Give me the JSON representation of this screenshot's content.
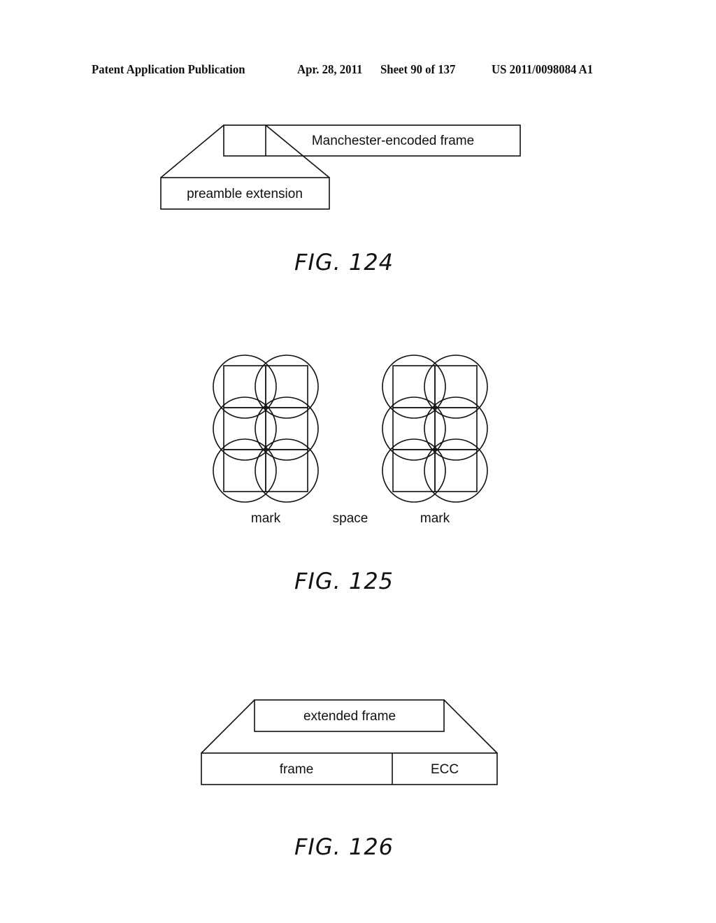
{
  "header": {
    "publication": "Patent Application Publication",
    "date": "Apr. 28, 2011",
    "sheet": "Sheet 90 of 137",
    "number": "US 2011/0098084 A1"
  },
  "fig124": {
    "caption": "FIG. 124",
    "frame_label": "Manchester-encoded frame",
    "extension_label": "preamble extension"
  },
  "fig125": {
    "caption": "FIG. 125",
    "grid": {
      "rows": 3,
      "cols": 2
    },
    "labels": [
      "mark",
      "space",
      "mark"
    ]
  },
  "fig126": {
    "caption": "FIG. 126",
    "extended_label": "extended frame",
    "frame_label": "frame",
    "ecc_label": "ECC"
  }
}
